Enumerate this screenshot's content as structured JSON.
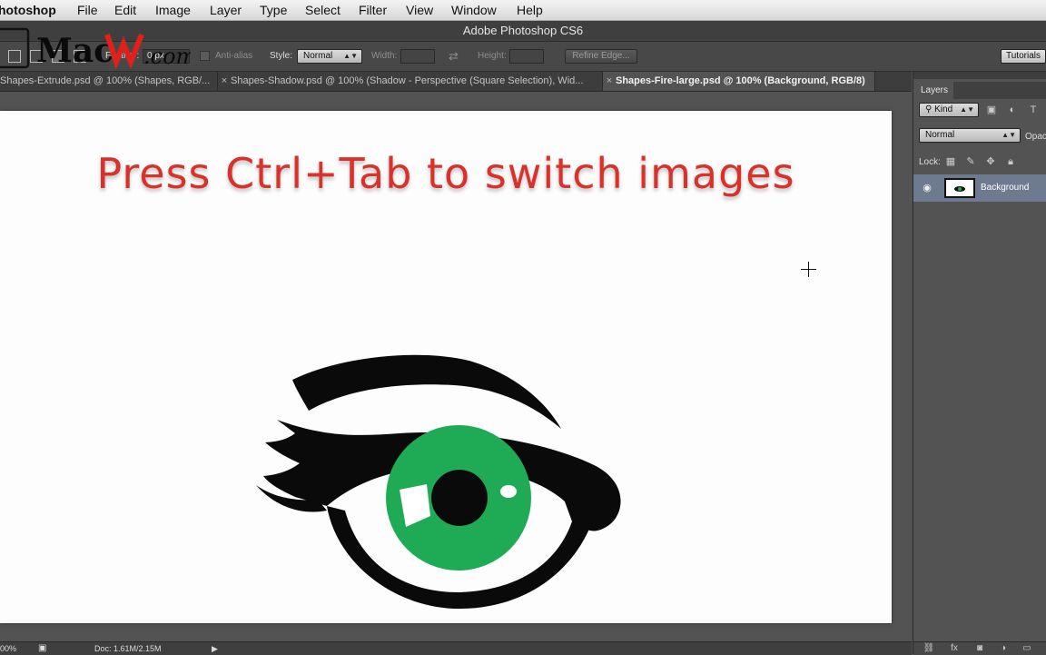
{
  "menubar": {
    "app": "hotoshop",
    "items": [
      "File",
      "Edit",
      "Image",
      "Layer",
      "Type",
      "Select",
      "Filter",
      "View",
      "Window",
      "Help"
    ]
  },
  "window": {
    "title": "Adobe Photoshop CS6"
  },
  "watermark": {
    "text_left": "Mac",
    "text_right": ".com"
  },
  "options": {
    "feather_label": "Feather:",
    "feather_value": "0 px",
    "antialias_label": "Anti-alias",
    "style_label": "Style:",
    "style_value": "Normal",
    "width_label": "Width:",
    "height_label": "Height:",
    "refine_edge": "Refine Edge...",
    "tutorials": "Tutorials"
  },
  "tabs": [
    {
      "label": "Shapes-Extrude.psd @ 100% (Shapes, RGB/...",
      "active": false
    },
    {
      "label": "Shapes-Shadow.psd @ 100% (Shadow - Perspective (Square Selection), Wid...",
      "active": false
    },
    {
      "label": "Shapes-Fire-large.psd @ 100% (Background, RGB/8)",
      "active": true
    }
  ],
  "canvas": {
    "headline": "Press Ctrl+Tab to switch images",
    "colors": {
      "text": "#d8322b",
      "iris": "#1faa55",
      "ink": "#0a0a0a"
    }
  },
  "layers_panel": {
    "title": "Layers",
    "filter_kind": "Kind",
    "blend_mode": "Normal",
    "opacity_label": "Opac",
    "lock_label": "Lock:",
    "layers": [
      {
        "name": "Background"
      }
    ]
  },
  "status": {
    "zoom": "00%",
    "doc": "Doc: 1.61M/2.15M"
  }
}
